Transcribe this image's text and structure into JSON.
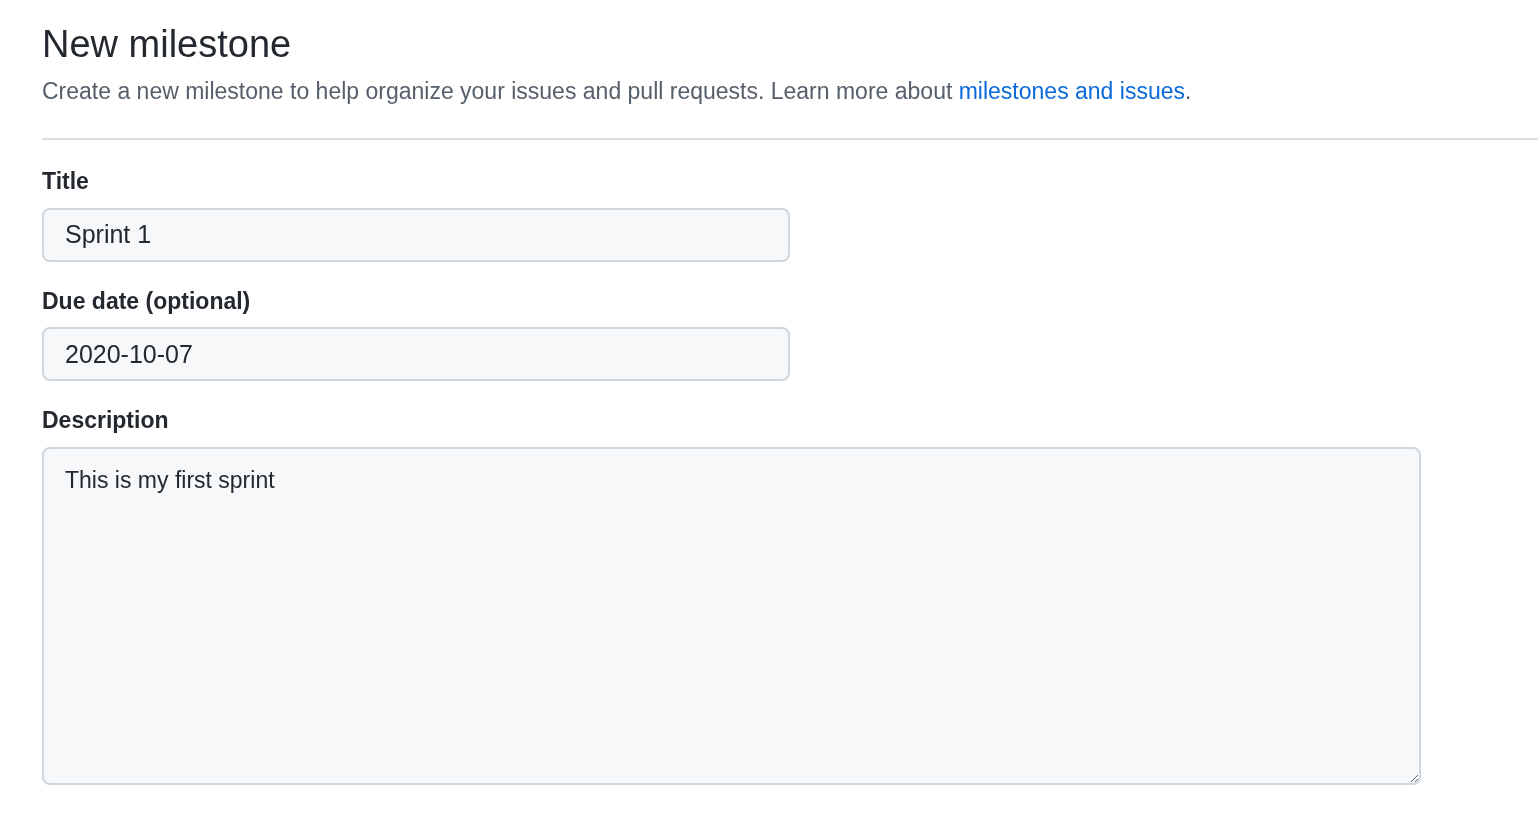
{
  "header": {
    "title": "New milestone",
    "intro": "Create a new milestone to help organize your issues and pull requests. Learn more about ",
    "link": "milestones and issues",
    "after": "."
  },
  "fields": [
    {
      "kind": "input",
      "label": "Title",
      "value": "Sprint 1"
    },
    {
      "kind": "input",
      "label": "Due date (optional)",
      "value": "2020-10-07"
    },
    {
      "kind": "textarea",
      "label": "Description",
      "value": "This is my first sprint"
    }
  ]
}
